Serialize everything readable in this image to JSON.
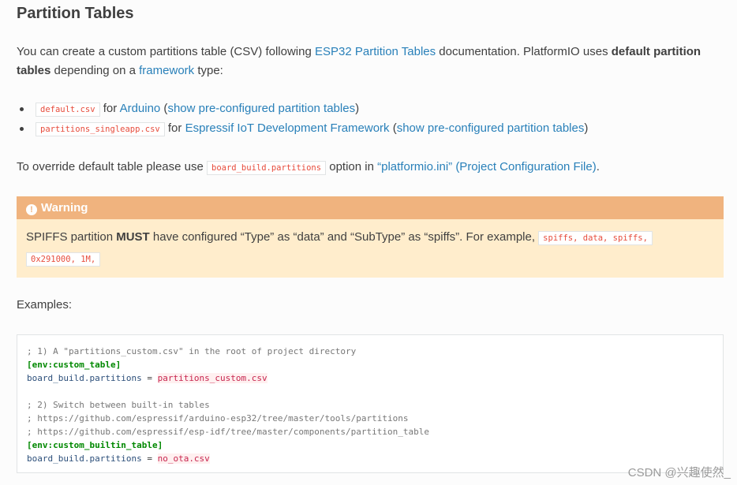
{
  "heading": "Partition Tables",
  "intro": {
    "t1": "You can create a custom partitions table (CSV) following ",
    "link1": "ESP32 Partition Tables",
    "t2": " documentation. PlatformIO uses ",
    "bold": "default partition tables",
    "t3": " depending on a ",
    "link2": "framework",
    "t4": " type:"
  },
  "list": [
    {
      "code": "default.csv",
      "for": " for ",
      "framework": "Arduino",
      "paren_open": " (",
      "show": "show pre-configured partition tables",
      "paren_close": ")"
    },
    {
      "code": "partitions_singleapp.csv",
      "for": " for ",
      "framework": "Espressif IoT Development Framework",
      "paren_open": " (",
      "show": "show pre-configured partition tables",
      "paren_close": ")"
    }
  ],
  "override": {
    "t1": "To override default table please use ",
    "code": "board_build.partitions",
    "t2": " option in ",
    "link": "“platformio.ini” (Project Configuration File)",
    "t3": "."
  },
  "warning": {
    "icon": "!",
    "title": "Warning",
    "t1": "SPIFFS partition ",
    "bold": "MUST",
    "t2": " have configured “Type” as “data” and “SubType” as “spiffs”. For example, ",
    "code1": "spiffs, data, spiffs,",
    "code2": "0x291000, 1M,"
  },
  "examples_label": "Examples:",
  "code": {
    "l1": "; 1) A \"partitions_custom.csv\" in the root of project directory",
    "l2": "[env:custom_table]",
    "l3_key": "board_build.partitions",
    "l3_eq": " = ",
    "l3_val": "partitions_custom.csv",
    "l5": "; 2) Switch between built-in tables",
    "l6": "; https://github.com/espressif/arduino-esp32/tree/master/tools/partitions",
    "l7": "; https://github.com/espressif/esp-idf/tree/master/components/partition_table",
    "l8": "[env:custom_builtin_table]",
    "l9_key": "board_build.partitions",
    "l9_eq": " = ",
    "l9_val": "no_ota.csv"
  },
  "watermark": "CSDN @兴趣使然_"
}
